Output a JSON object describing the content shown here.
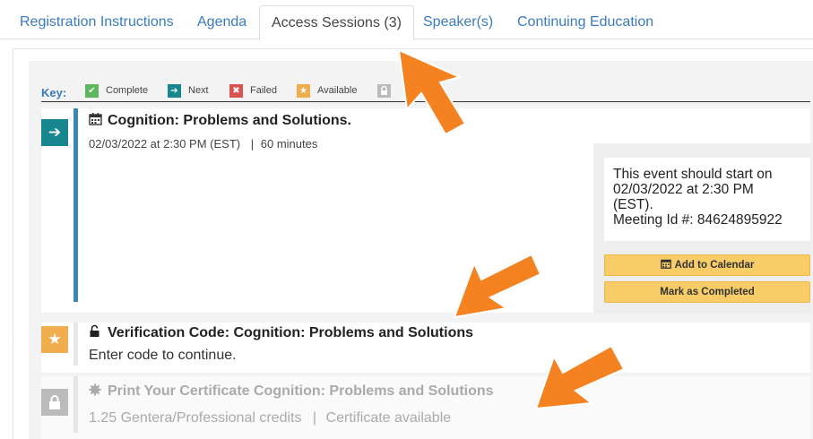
{
  "tabs": [
    {
      "label": "Registration Instructions"
    },
    {
      "label": "Agenda"
    },
    {
      "label": "Access Sessions (3)"
    },
    {
      "label": "Speaker(s)"
    },
    {
      "label": "Continuing Education"
    }
  ],
  "key": {
    "label": "Key:",
    "items": [
      {
        "label": "Complete",
        "color": "#5cb85c",
        "icon": "check-icon"
      },
      {
        "label": "Next",
        "color": "#17868f",
        "icon": "arrow-right-icon"
      },
      {
        "label": "Failed",
        "color": "#d9534f",
        "icon": "x-icon"
      },
      {
        "label": "Available",
        "color": "#f0ad4e",
        "icon": "star-icon"
      },
      {
        "label": "",
        "color": "#bbbbbb",
        "icon": "lock-icon"
      }
    ]
  },
  "sessions": [
    {
      "title": "Cognition: Problems and Solutions.",
      "title_icon": "calendar-icon",
      "status_icon": "arrow-right-icon",
      "status_color": "#17868f",
      "bar_color": "#3a8ab0",
      "date": "02/03/2022 at 2:30 PM (EST)",
      "separator": "|",
      "duration": "60 minutes"
    },
    {
      "title": "Verification Code: Cognition: Problems and Solutions",
      "title_icon": "unlock-icon",
      "status_icon": "star-icon",
      "status_color": "#f0ad4e",
      "subtitle": "Enter code to continue."
    },
    {
      "title": "Print Your Certificate Cognition: Problems and Solutions",
      "title_icon": "certificate-icon",
      "status_icon": "lock-icon",
      "status_color": "#bbbbbb",
      "credits": "1.25 Gentera/Professional credits",
      "separator": "|",
      "certificate": "Certificate available"
    }
  ],
  "card": {
    "message_line1": "This event should start on",
    "message_line2": "02/03/2022 at 2:30 PM",
    "message_line3": "(EST).",
    "meeting_id": "Meeting Id #: 84624895922",
    "add_to_calendar": "Add to Calendar",
    "mark_completed": "Mark as Completed"
  },
  "colors": {
    "tab_link": "#3a7bbf",
    "annotation_arrow": "#f58220",
    "button": "#f8cc66"
  }
}
